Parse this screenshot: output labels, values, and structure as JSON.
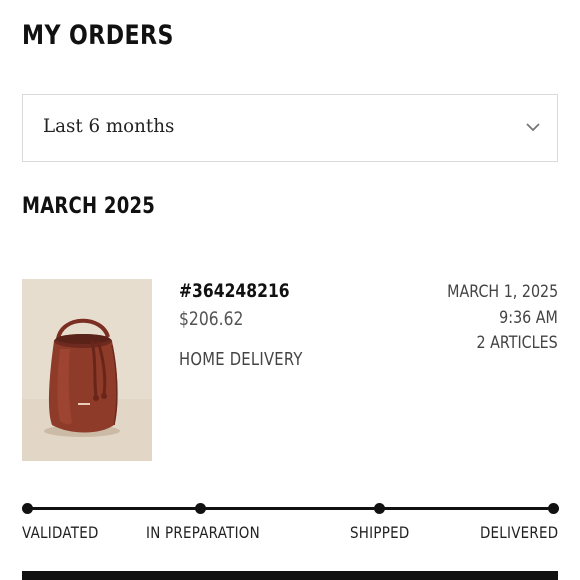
{
  "header": {
    "title": "MY ORDERS"
  },
  "filter": {
    "selected": "Last 6 months",
    "icon": "chevron-down-icon"
  },
  "section": {
    "month": "MARCH 2025"
  },
  "order": {
    "number": "#364248216",
    "total": "$206.62",
    "delivery": "HOME DELIVERY",
    "date": "MARCH 1, 2025",
    "time": "9:36 AM",
    "articles": "2 ARTICLES",
    "image": "brown-leather-bucket-bag"
  },
  "tracker": {
    "steps": [
      "VALIDATED",
      "IN PREPARATION",
      "SHIPPED",
      "DELIVERED"
    ],
    "completed": 4
  },
  "colors": {
    "text": "#111111",
    "muted": "#555555",
    "border": "#d9d9d9",
    "bag": "#8e3b2a",
    "thumb_bg": "#e7ddcf"
  }
}
